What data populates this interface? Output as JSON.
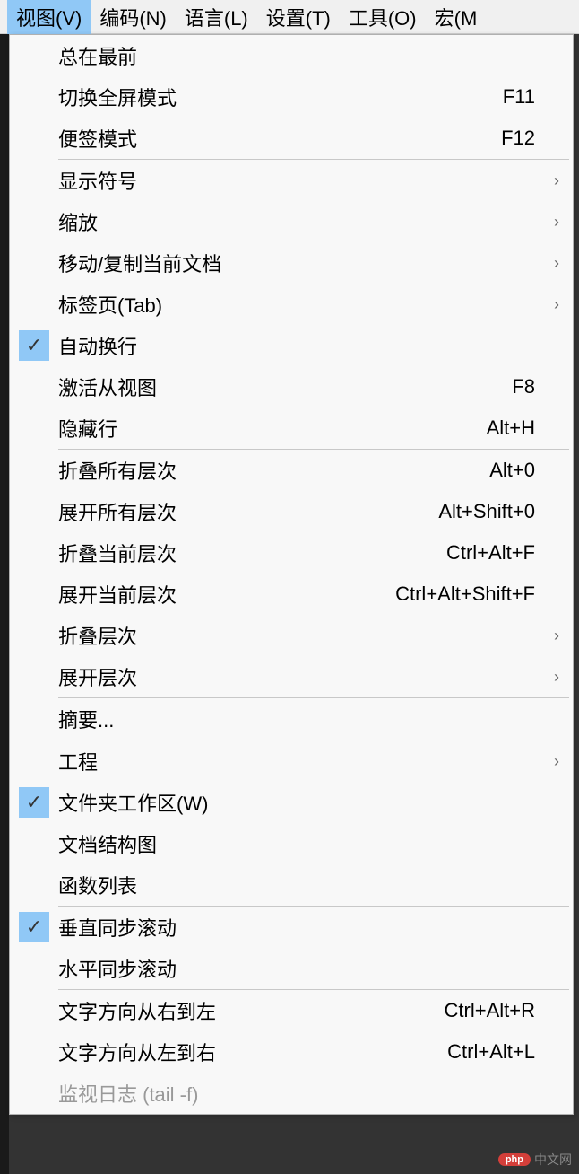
{
  "menubar": {
    "view": "视图(V)",
    "encoding": "编码(N)",
    "language": "语言(L)",
    "settings": "设置(T)",
    "tools": "工具(O)",
    "macro": "宏(M"
  },
  "menu": {
    "items": [
      {
        "label": "总在最前",
        "shortcut": "",
        "checked": false,
        "submenu": false,
        "disabled": false,
        "name": "always-on-top"
      },
      {
        "label": "切换全屏模式",
        "shortcut": "F11",
        "checked": false,
        "submenu": false,
        "disabled": false,
        "name": "toggle-fullscreen"
      },
      {
        "label": "便签模式",
        "shortcut": "F12",
        "checked": false,
        "submenu": false,
        "disabled": false,
        "name": "sticky-note-mode"
      },
      {
        "sep": true
      },
      {
        "label": "显示符号",
        "shortcut": "",
        "checked": false,
        "submenu": true,
        "disabled": false,
        "name": "show-symbols"
      },
      {
        "label": "缩放",
        "shortcut": "",
        "checked": false,
        "submenu": true,
        "disabled": false,
        "name": "zoom"
      },
      {
        "label": "移动/复制当前文档",
        "shortcut": "",
        "checked": false,
        "submenu": true,
        "disabled": false,
        "name": "move-copy-doc"
      },
      {
        "label": "标签页(Tab)",
        "shortcut": "",
        "checked": false,
        "submenu": true,
        "disabled": false,
        "name": "tabs"
      },
      {
        "label": "自动换行",
        "shortcut": "",
        "checked": true,
        "submenu": false,
        "disabled": false,
        "name": "word-wrap"
      },
      {
        "label": "激活从视图",
        "shortcut": "F8",
        "checked": false,
        "submenu": false,
        "disabled": false,
        "name": "activate-sub-view"
      },
      {
        "label": "隐藏行",
        "shortcut": "Alt+H",
        "checked": false,
        "submenu": false,
        "disabled": false,
        "name": "hide-lines"
      },
      {
        "sep": true
      },
      {
        "label": "折叠所有层次",
        "shortcut": "Alt+0",
        "checked": false,
        "submenu": false,
        "disabled": false,
        "name": "fold-all"
      },
      {
        "label": "展开所有层次",
        "shortcut": "Alt+Shift+0",
        "checked": false,
        "submenu": false,
        "disabled": false,
        "name": "unfold-all"
      },
      {
        "label": "折叠当前层次",
        "shortcut": "Ctrl+Alt+F",
        "checked": false,
        "submenu": false,
        "disabled": false,
        "name": "fold-current"
      },
      {
        "label": "展开当前层次",
        "shortcut": "Ctrl+Alt+Shift+F",
        "checked": false,
        "submenu": false,
        "disabled": false,
        "name": "unfold-current"
      },
      {
        "label": "折叠层次",
        "shortcut": "",
        "checked": false,
        "submenu": true,
        "disabled": false,
        "name": "fold-level"
      },
      {
        "label": "展开层次",
        "shortcut": "",
        "checked": false,
        "submenu": true,
        "disabled": false,
        "name": "unfold-level"
      },
      {
        "sep": true
      },
      {
        "label": "摘要...",
        "shortcut": "",
        "checked": false,
        "submenu": false,
        "disabled": false,
        "name": "summary"
      },
      {
        "sep": true
      },
      {
        "label": "工程",
        "shortcut": "",
        "checked": false,
        "submenu": true,
        "disabled": false,
        "name": "project"
      },
      {
        "label": "文件夹工作区(W)",
        "shortcut": "",
        "checked": true,
        "submenu": false,
        "disabled": false,
        "name": "folder-workspace"
      },
      {
        "label": "文档结构图",
        "shortcut": "",
        "checked": false,
        "submenu": false,
        "disabled": false,
        "name": "doc-map"
      },
      {
        "label": "函数列表",
        "shortcut": "",
        "checked": false,
        "submenu": false,
        "disabled": false,
        "name": "function-list"
      },
      {
        "sep": true
      },
      {
        "label": "垂直同步滚动",
        "shortcut": "",
        "checked": true,
        "submenu": false,
        "disabled": false,
        "name": "sync-vertical-scroll"
      },
      {
        "label": "水平同步滚动",
        "shortcut": "",
        "checked": false,
        "submenu": false,
        "disabled": false,
        "name": "sync-horizontal-scroll"
      },
      {
        "sep": true
      },
      {
        "label": "文字方向从右到左",
        "shortcut": "Ctrl+Alt+R",
        "checked": false,
        "submenu": false,
        "disabled": false,
        "name": "text-rtl"
      },
      {
        "label": "文字方向从左到右",
        "shortcut": "Ctrl+Alt+L",
        "checked": false,
        "submenu": false,
        "disabled": false,
        "name": "text-ltr"
      },
      {
        "label": "监视日志 (tail -f)",
        "shortcut": "",
        "checked": false,
        "submenu": false,
        "disabled": true,
        "name": "monitor-log"
      }
    ]
  },
  "watermark": {
    "badge": "php",
    "text": "中文网"
  }
}
